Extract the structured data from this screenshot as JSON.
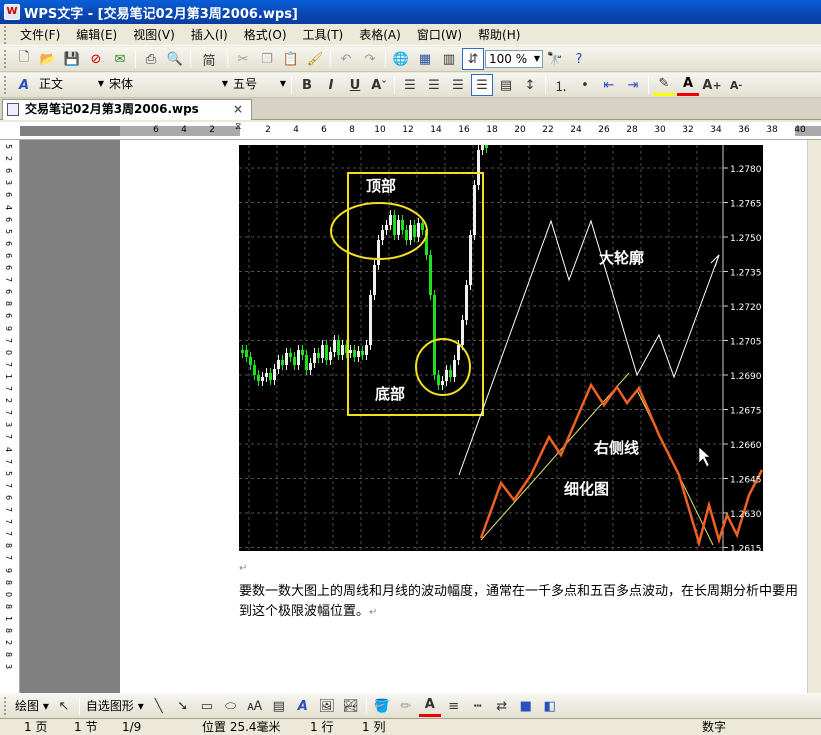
{
  "window": {
    "title": "WPS文字 - [交易笔记02月第3周2006.wps]",
    "app_icon": "W"
  },
  "menu": [
    "文件(F)",
    "编辑(E)",
    "视图(V)",
    "插入(I)",
    "格式(O)",
    "工具(T)",
    "表格(A)",
    "窗口(W)",
    "帮助(H)"
  ],
  "toolbar": {
    "zoom": "100 %",
    "simplified": "简"
  },
  "format_bar": {
    "style": "正文",
    "font": "宋体",
    "size": "五号"
  },
  "doc_tab": "交易笔记02月第3周2006.wps",
  "ruler": {
    "ticks": [
      "6",
      "4",
      "2",
      "",
      "2",
      "4",
      "6",
      "8",
      "10",
      "12",
      "14",
      "16",
      "18",
      "20",
      "22",
      "24",
      "26",
      "28",
      "30",
      "32",
      "34",
      "36",
      "38",
      "40"
    ]
  },
  "vruler": {
    "ticks": [
      "5",
      "2",
      "6",
      "3",
      "6",
      "4",
      "6",
      "5",
      "6",
      "6",
      "6",
      "7",
      "6",
      "8",
      "6",
      "9",
      "7",
      "0",
      "7",
      "1",
      "7",
      "2",
      "7",
      "3",
      "7",
      "4",
      "7",
      "5",
      "7",
      "6",
      "7",
      "7",
      "7",
      "8",
      "7",
      "9",
      "8",
      "0",
      "8",
      "1",
      "8",
      "2",
      "8",
      "3"
    ]
  },
  "chart": {
    "price_labels": [
      "1.2780",
      "1.2765",
      "1.2750",
      "1.2735",
      "1.2720",
      "1.2705",
      "1.2690",
      "1.2675",
      "1.2660",
      "1.2645",
      "1.2630",
      "1.2615"
    ],
    "annotations": {
      "top": "顶部",
      "bottom": "底部",
      "big_outline": "大轮廓",
      "right_line": "右侧线",
      "detail": "细化图"
    }
  },
  "caption": "要数一数大图上的周线和月线的波动幅度，通常在一千多点和五百多点波动，在长周期分析中要用到这个极限波幅位置。",
  "drawbar": {
    "draw": "绘图",
    "autoshape": "自选图形"
  },
  "status": {
    "page": "1 页",
    "section": "1 节",
    "pages": "1/9",
    "position": "位置 25.4毫米",
    "line": "1 行",
    "col": "1 列",
    "mode": "数字"
  }
}
